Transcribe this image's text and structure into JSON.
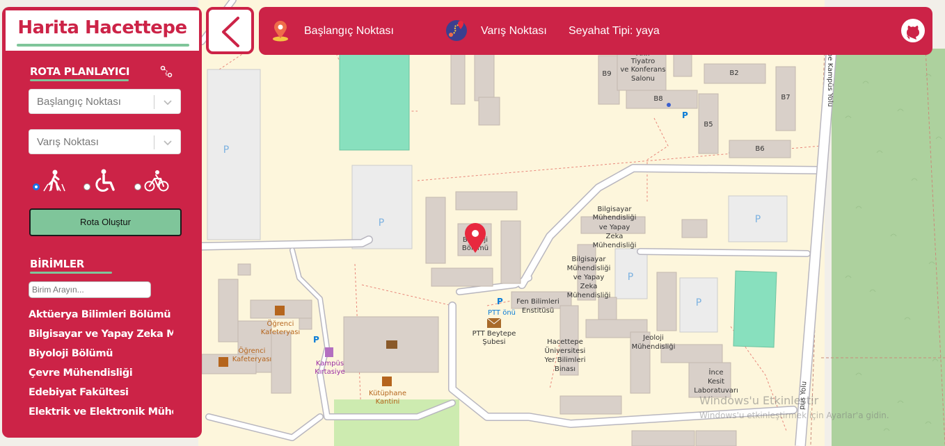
{
  "brand": {
    "title": "Harita Hacettepe"
  },
  "route_planner": {
    "title": "ROTA PLANLAYICI",
    "start_select": {
      "placeholder": "Başlangıç Noktası"
    },
    "end_select": {
      "placeholder": "Varış Noktası"
    },
    "modes": [
      {
        "name": "walking",
        "icon": "pedestrian-icon",
        "selected": true
      },
      {
        "name": "wheelchair",
        "icon": "wheelchair-icon",
        "selected": false
      },
      {
        "name": "bicycle",
        "icon": "bicycle-icon",
        "selected": false
      }
    ],
    "create_button": "Rota Oluştur"
  },
  "units": {
    "title": "BİRİMLER",
    "search_placeholder": "Birim Arayın...",
    "items": [
      "Aktüerya Bilimleri Bölümü",
      "Bilgisayar ve Yapay Zeka Mühendisliği",
      "Biyoloji Bölümü",
      "Çevre Mühendisliği",
      "Edebiyat Fakültesi",
      "Elektrik ve Elektronik Mühendisliği"
    ]
  },
  "header": {
    "start_label": "Başlangıç Noktası",
    "end_label": "Varış Noktası",
    "travel_type": "Seyahat Tipi: yaya"
  },
  "map": {
    "labels": {
      "b9": "B9",
      "anfi1": "Tiyatro",
      "anfi2": "ve Konferans",
      "anfi3": "Salonu",
      "anfi0": "Anfi",
      "b2": "B2",
      "b8": "B8",
      "b7": "B7",
      "b5": "B5",
      "b6": "B6",
      "bilg1_1": "Bilgisayar",
      "bilg1_2": "Mühendisliği",
      "bilg1_3": "ve Yapay",
      "bilg1_4": "Zeka",
      "bilg1_5": "Mühendisliği",
      "bilg2_1": "Bilgisayar",
      "bilg2_2": "Mühendisliği",
      "bilg2_3": "ve Yapay",
      "bilg2_4": "Zeka",
      "bilg2_5": "Mühendisliği",
      "biyo1": "Biyoloji",
      "biyo2": "Bölümü",
      "fen1": "Fen Bilimleri",
      "fen2": "Enstitüsü",
      "ptt_onu": "PTT önü",
      "ptt1": "PTT Beytepe",
      "ptt2": "Şubesi",
      "hu1": "Hacettepe",
      "hu2": "Üniversitesi",
      "hu3": "Yer Bilimleri",
      "hu4": "Binası",
      "jeo1": "Jeoloji",
      "jeo2": "Mühendisliği",
      "ince1": "İnce",
      "ince2": "Kesit",
      "ince3": "Laboratuvarı",
      "caf1_1": "Öğrenci",
      "caf1_2": "Kafeteryası",
      "caf2_1": "Öğrenci",
      "caf2_2": "Kafeteryası",
      "kirt1": "Kampüs",
      "kirt2": "Kırtasiye",
      "kut1": "Kütüphane",
      "kut2": "Kantini",
      "road1": "pe Kampüs Yolu",
      "road2": "pus Yolu",
      "p": "P"
    },
    "watermark": {
      "line1": "Windows'u Etkinleştir",
      "line2": "Windows'u etkinleştirmek için Ayarlar'a gidin."
    }
  },
  "colors": {
    "primary": "#cc2347",
    "accent": "#7fc59a",
    "map_bg": "#f2efe9",
    "building": "#d9d0c9",
    "pitch": "#88e0be",
    "forest": "#add19e"
  }
}
